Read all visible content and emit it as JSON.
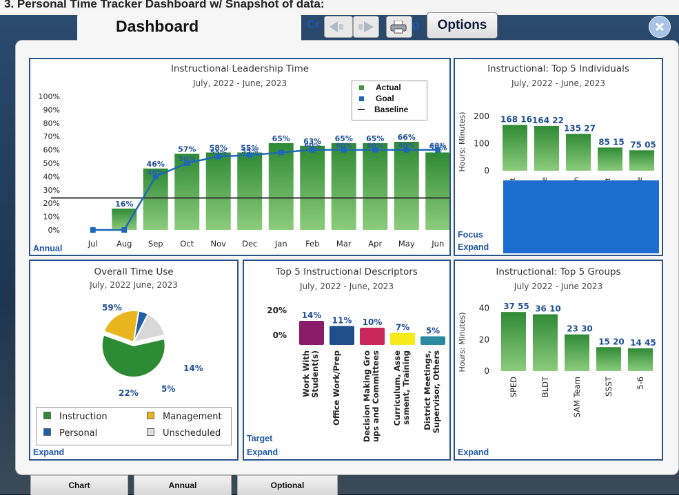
{
  "window": {
    "top_caption": "3. Personal Time Tracker Dashboard w/ Snapshot of data:",
    "title": "Dashboard",
    "title_fragment": "Cr",
    "options_label": "Options"
  },
  "toolbar": {
    "back_icon": "back-arrow-icon",
    "forward_icon": "forward-arrow-icon",
    "print_icon": "printer-icon"
  },
  "colors": {
    "bar_green": "#3e9a3e",
    "series_blue": "#1f67b7",
    "baseline": "#333333",
    "accent": "#27538a",
    "focus_block": "#1e6ed0"
  },
  "panels": {
    "ilt": {
      "title": "Instructional Leadership Time",
      "subtitle": "July, 2022 - June, 2023",
      "link": "Annual",
      "legend": [
        {
          "label": "Actual",
          "color": "#3e9a3e",
          "icon": "square"
        },
        {
          "label": "Goal",
          "color": "#1f67b7",
          "icon": "square"
        },
        {
          "label": "Baseline",
          "color": "#333333",
          "icon": "line"
        }
      ]
    },
    "top5ind": {
      "title": "Instructional: Top 5 Individuals",
      "subtitle": "July, 2022 - June, 2023",
      "ylabel": "Hours: Minutes)",
      "link_focus": "Focus",
      "link_expand": "Expand"
    },
    "overall": {
      "title": "Overall Time Use",
      "subtitle": "July, 2022   June, 2023",
      "link": "Expand",
      "legend": [
        {
          "label": "Instruction",
          "color": "#2e8b35"
        },
        {
          "label": "Management",
          "color": "#e8b51e"
        },
        {
          "label": "Personal",
          "color": "#1e5fa8"
        },
        {
          "label": "Unscheduled",
          "color": "#dddddd"
        }
      ]
    },
    "descriptors": {
      "title": "Top 5 Instructional Descriptors",
      "subtitle": "July, 2022 - June, 2023",
      "link_target": "Target",
      "link_expand": "Expand"
    },
    "groups": {
      "title": "Instructional: Top 5 Groups",
      "subtitle": "July  2022 - June  2023",
      "ylabel": "Hours: Minutes)",
      "link": "Expand"
    }
  },
  "bottom_tabs": [
    "Chart",
    "Annual",
    "Optional"
  ],
  "chart_data": [
    {
      "id": "ilt",
      "type": "bar",
      "title": "Instructional Leadership Time",
      "categories": [
        "Jul",
        "Aug",
        "Sep",
        "Oct",
        "Nov",
        "Dec",
        "Jan",
        "Feb",
        "Mar",
        "Apr",
        "May",
        "Jun"
      ],
      "series": [
        {
          "name": "Actual",
          "values": [
            0,
            16,
            46,
            57,
            58,
            58,
            65,
            63,
            65,
            65,
            66,
            58
          ],
          "labels": [
            "",
            "16%",
            "46%",
            "57%",
            "58%",
            "55%",
            "65%",
            "63%",
            "65%",
            "65%",
            "66%",
            "58%"
          ]
        },
        {
          "name": "Goal",
          "values": [
            0,
            0,
            40,
            50,
            55,
            56,
            58,
            60,
            60,
            60,
            60,
            60
          ],
          "labels": [
            "",
            "",
            "40%",
            "50%",
            "55%",
            "55%",
            "",
            "60%",
            "60%",
            "60%",
            "60%",
            "60%"
          ]
        },
        {
          "name": "Baseline",
          "values": [
            24,
            24,
            24,
            24,
            24,
            24,
            24,
            24,
            24,
            24,
            24,
            24
          ]
        }
      ],
      "yticks": [
        "0%",
        "10%",
        "20%",
        "30%",
        "40%",
        "50%",
        "60%",
        "70%",
        "80%",
        "90%",
        "100%"
      ],
      "ylim": [
        0,
        100
      ],
      "legend_position": "top-right"
    },
    {
      "id": "top5ind",
      "type": "bar",
      "title": "Instructional: Top 5 Individuals",
      "categories": [
        "t",
        "e",
        "h",
        "t",
        "e"
      ],
      "values": [
        168,
        164,
        135,
        85,
        75
      ],
      "labels": [
        "168 16",
        "164 22",
        "135 27",
        "85 15",
        "75 05"
      ],
      "yticks": [
        "0",
        "100",
        "200"
      ],
      "ylim": [
        0,
        210
      ]
    },
    {
      "id": "overall",
      "type": "pie",
      "title": "Overall Time Use",
      "slices": [
        {
          "label": "Instruction",
          "value": 59,
          "text": "59%"
        },
        {
          "label": "Management",
          "value": 22,
          "text": "22%"
        },
        {
          "label": "Personal",
          "value": 5,
          "text": "5%"
        },
        {
          "label": "Unscheduled",
          "value": 14,
          "text": "14%"
        }
      ]
    },
    {
      "id": "descriptors",
      "type": "bar",
      "title": "Top 5 Instructional Descriptors",
      "categories": [
        "Work With Student(s)",
        "Office Work/Prep",
        "Decision Making Groups and Committees",
        "Curriculum, Assessment, Training",
        "District Meetings, Supervisor, Others"
      ],
      "values": [
        14,
        11,
        10,
        7,
        5
      ],
      "labels": [
        "14%",
        "11%",
        "10%",
        "7%",
        "5%"
      ],
      "colors": [
        "#8a1d6a",
        "#1f4f8a",
        "#c8275a",
        "#f5ea1a",
        "#2a8aa0"
      ],
      "yticks": [
        "0%",
        "20%"
      ],
      "ylim": [
        0,
        20
      ]
    },
    {
      "id": "groups",
      "type": "bar",
      "title": "Instructional: Top 5 Groups",
      "categories": [
        "SPED",
        "BLDT",
        "SAM Team",
        "SSST",
        "5-6"
      ],
      "values": [
        37.55,
        36.1,
        23.3,
        15.2,
        14.45
      ],
      "labels": [
        "37 55",
        "36 10",
        "23 30",
        "15 20",
        "14 45"
      ],
      "yticks": [
        "0",
        "20",
        "40"
      ],
      "ylim": [
        0,
        42
      ]
    }
  ]
}
